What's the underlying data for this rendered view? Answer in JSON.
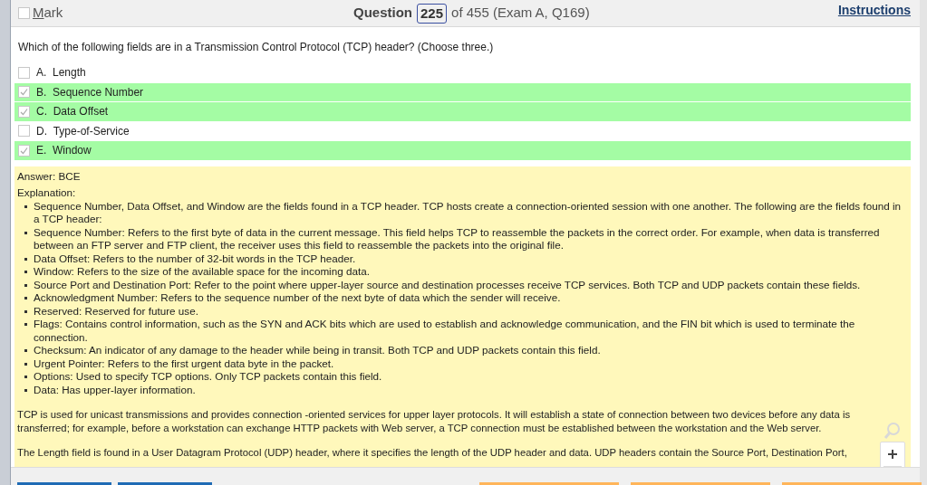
{
  "header": {
    "mark": {
      "label": "Mark",
      "checked": false
    },
    "question_label": "Question",
    "question_number": "225",
    "question_of": "of 455 (Exam A, Q169)",
    "instructions": "Instructions"
  },
  "question": "Which of the following fields are in a Transmission Control Protocol (TCP) header? (Choose three.)",
  "options": [
    {
      "letter": "A.",
      "text": "Length",
      "checked": false,
      "highlighted": false
    },
    {
      "letter": "B.",
      "text": "Sequence Number",
      "checked": true,
      "highlighted": true
    },
    {
      "letter": "C.",
      "text": "Data Offset",
      "checked": true,
      "highlighted": true
    },
    {
      "letter": "D.",
      "text": "Type-of-Service",
      "checked": false,
      "highlighted": false
    },
    {
      "letter": "E.",
      "text": "Window",
      "checked": true,
      "highlighted": true
    }
  ],
  "answer": {
    "answer_line": "Answer: BCE",
    "explanation_label": "Explanation:",
    "bullets": [
      "Sequence Number, Data Offset, and Window are the fields found in a TCP header. TCP hosts create a connection-oriented session with one another. The following are the fields found in a TCP header:",
      "Sequence Number: Refers to the first byte of data in the current message. This field helps TCP to reassemble the packets in the correct order. For example, when data is transferred between an FTP server and FTP client, the receiver uses this field to reassemble the packets into the original file.",
      "Data Offset: Refers to the number of 32-bit words in the TCP header.",
      "Window: Refers to the size of the available space for the incoming data.",
      "Source Port and Destination Port: Refer to the point where upper-layer source and destination processes receive TCP services. Both TCP and UDP packets contain these fields.",
      "Acknowledgment Number: Refers to the sequence number of the next byte of data which the sender will receive.",
      "Reserved: Reserved for future use.",
      "Flags: Contains control information, such as the SYN and ACK bits which are used to establish and acknowledge communication, and the FIN bit which is used to terminate the connection.",
      "Checksum: An indicator of any damage to the header while being in transit. Both TCP and UDP packets contain this field.",
      "Urgent Pointer: Refers to the first urgent data byte in the packet.",
      "Options: Used to specify TCP options. Only TCP packets contain this field.",
      "Data: Has upper-layer information."
    ],
    "paragraphs": [
      "TCP is used for unicast transmissions and provides connection -oriented services for upper layer protocols. It will establish a state of connection between two devices before any data is transferred; for example, before a workstation can exchange HTTP packets with Web server, a TCP connection must be established between the workstation and the Web server.",
      "The Length field is found in a User Datagram Protocol (UDP) header, where it specifies the length of the UDP header and data. UDP headers contain the Source Port, Destination Port,"
    ]
  }
}
